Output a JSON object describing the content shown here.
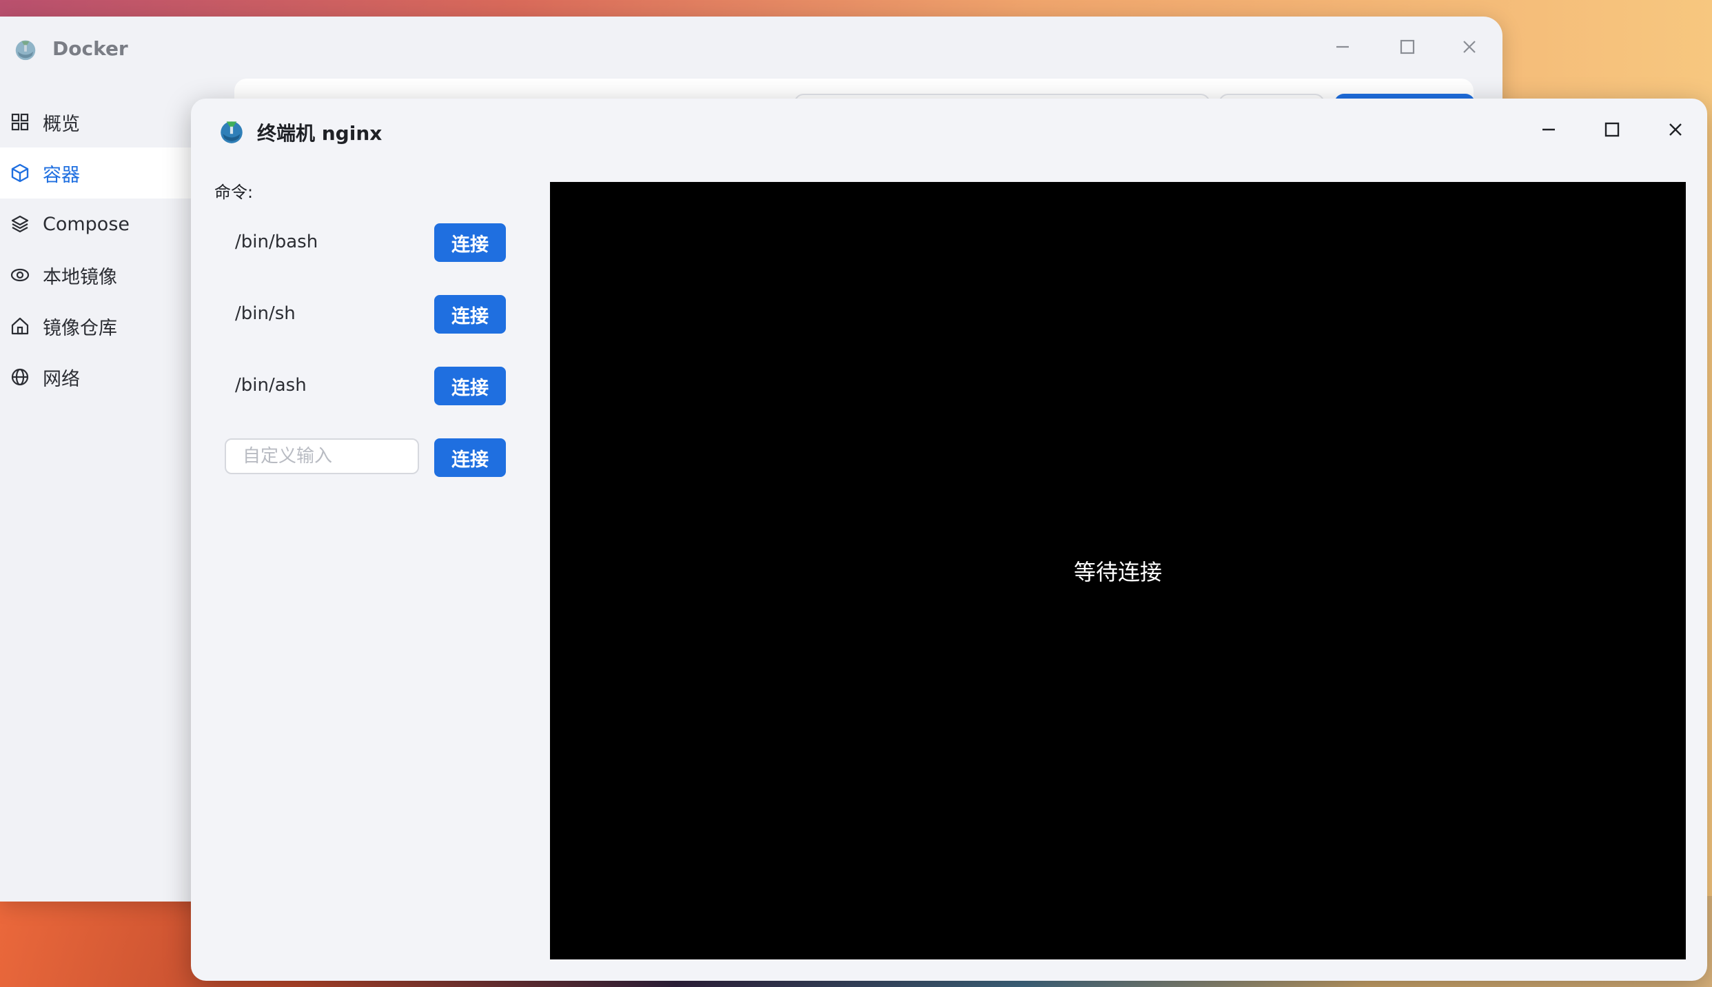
{
  "main_window": {
    "title": "Docker",
    "sidebar": {
      "items": [
        {
          "label": "概览",
          "icon": "grid-icon",
          "active": false
        },
        {
          "label": "容器",
          "icon": "box-icon",
          "active": true
        },
        {
          "label": "Compose",
          "icon": "layers-icon",
          "active": false
        },
        {
          "label": "本地镜像",
          "icon": "eye-icon",
          "active": false
        },
        {
          "label": "镜像仓库",
          "icon": "home-icon",
          "active": false
        },
        {
          "label": "网络",
          "icon": "globe-icon",
          "active": false
        }
      ]
    }
  },
  "terminal_window": {
    "title": "终端机 nginx",
    "command_label": "命令:",
    "commands": [
      {
        "command": "/bin/bash",
        "button": "连接"
      },
      {
        "command": "/bin/sh",
        "button": "连接"
      },
      {
        "command": "/bin/ash",
        "button": "连接"
      }
    ],
    "custom": {
      "placeholder": "自定义输入",
      "value": "",
      "button": "连接"
    },
    "screen_status": "等待连接"
  },
  "colors": {
    "accent": "#1f6fe0",
    "terminal_bg": "#000000",
    "window_bg": "#f3f4f8"
  }
}
